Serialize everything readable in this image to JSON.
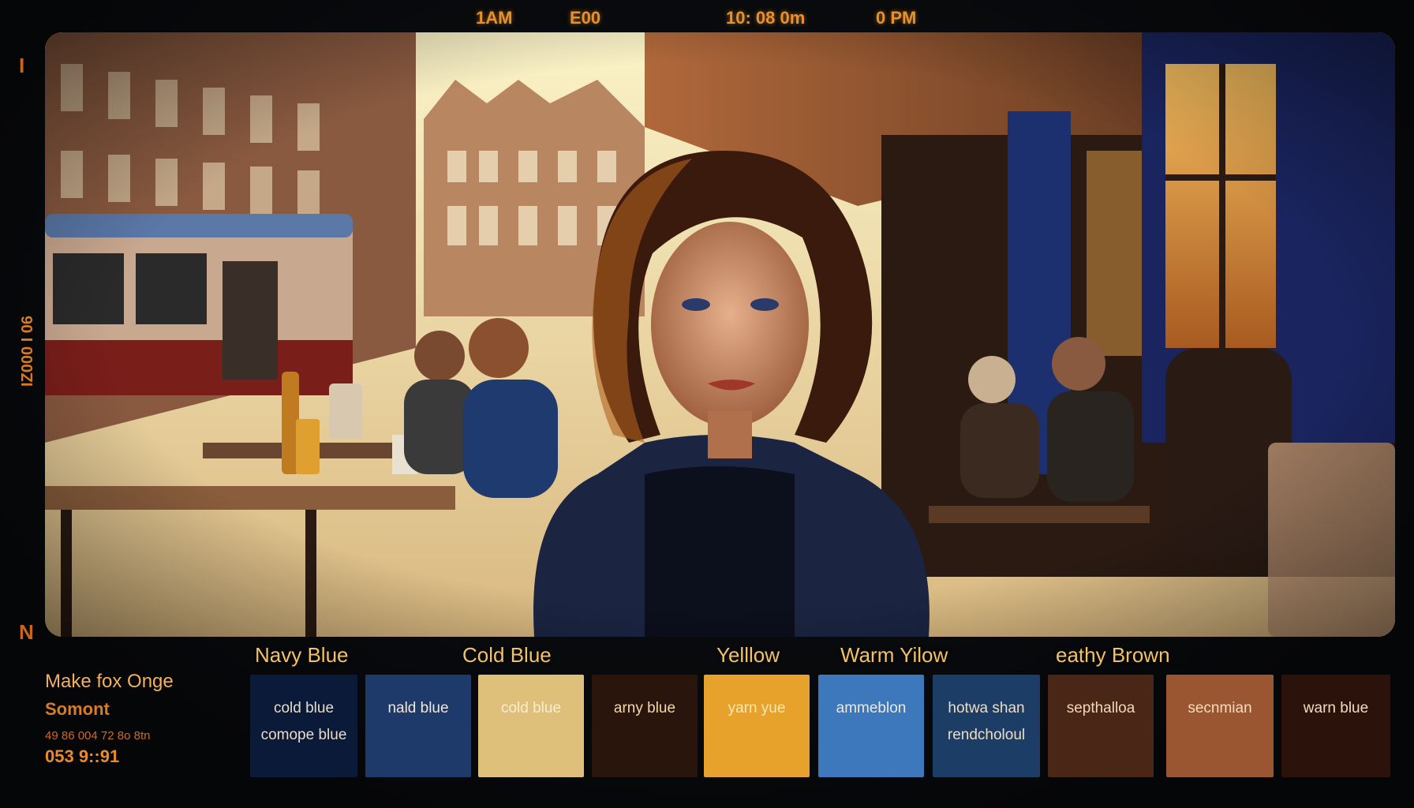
{
  "timecode": {
    "top": [
      "1AM",
      "E00",
      "10: 08 0m",
      "0 PM"
    ],
    "side": "IZ000 I 06"
  },
  "side_marks": [
    "I",
    "N"
  ],
  "photo": {
    "subject": "woman in navy sweater at cafe table",
    "colors": {
      "sky": "#f3e6b0",
      "building": "#9a6a4a",
      "sweater": "#1b2542",
      "hair": "#3b1a0e",
      "window_glow": "#f0a040",
      "tile": "#1c2a6a"
    }
  },
  "caption": {
    "line1": "Make fox Onge",
    "line2": "Somont",
    "line3": "49  86  004 72   8o  8tn",
    "line4": "053        9::91"
  },
  "palette": {
    "headers": [
      "Navy Blue",
      "Cold Blue",
      "Yelllow",
      "Warm Yilow",
      "eathy Brown"
    ],
    "swatches": [
      {
        "color": "#0c1a3a",
        "text_color": "#e8dcc4",
        "lines": [
          "cold blue",
          "comope blue"
        ]
      },
      {
        "color": "#1d3a6a",
        "text_color": "#f4e8d0",
        "lines": [
          "nald blue"
        ]
      },
      {
        "color": "#dfc07a",
        "text_color": "#f8ecd2",
        "lines": [
          "cold blue"
        ]
      },
      {
        "color": "#2a150c",
        "text_color": "#f2d8a8",
        "lines": [
          "arny blue"
        ]
      },
      {
        "color": "#e6a22a",
        "text_color": "#fbe7b0",
        "lines": [
          "yarn yue"
        ]
      },
      {
        "color": "#3d78bc",
        "text_color": "#f2e8d6",
        "lines": [
          "ammeblon"
        ]
      },
      {
        "color": "#1c3d66",
        "text_color": "#f0dcc0",
        "lines": [
          "hotwa shan",
          "rendcholoul"
        ]
      },
      {
        "color": "#4a2616",
        "text_color": "#f2d8b8",
        "lines": [
          "septhalloa"
        ]
      },
      {
        "color": "#9a5630",
        "text_color": "#f6dcc0",
        "lines": [
          "secnmian"
        ]
      },
      {
        "color": "#2b120a",
        "text_color": "#f2dcc0",
        "lines": [
          "warn blue"
        ]
      }
    ]
  }
}
